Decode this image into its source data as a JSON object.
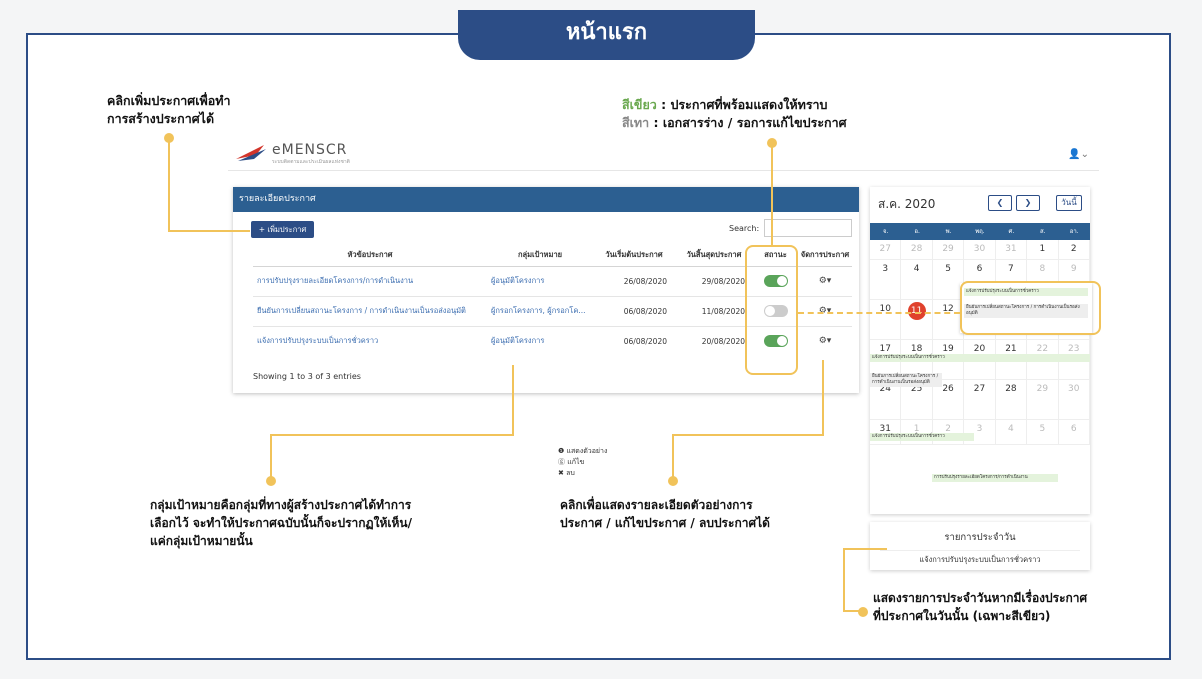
{
  "title": "หน้าแรก",
  "notes": {
    "add": [
      "คลิกเพิ่มประกาศเพื่อทำ",
      "การสร้างประกาศได้"
    ],
    "status_green_label": "สีเขียว",
    "status_green_text": " : ประกาศที่พร้อมแสดงให้ทราบ",
    "status_gray_label": "สีเทา",
    "status_gray_text": " : เอกสารร่าง / รอการแก้ไขประกาศ",
    "target": [
      "กลุ่มเป้าหมายคือกลุ่มที่ทางผู้สร้างประกาศได้ทำการ",
      "เลือกไว้ จะทำให้ประกาศฉบับนั้นก็จะปรากฏให้เห็น/",
      "แค่กลุ่มเป้าหมายนั้น"
    ],
    "action": [
      "คลิกเพื่อแสดงรายละเอียดตัวอย่างการ",
      "ประกาศ / แก้ไขประกาศ / ลบประกาศได้"
    ],
    "daily": [
      "แสดงรายการประจำวันหากมีเรื่องประกาศ",
      "ที่ประกาศในวันนั้น (เฉพาะสีเขียว)"
    ]
  },
  "app": {
    "logo": "eMENSCR",
    "logo_sub": "ระบบติดตามและประเมินผลแห่งชาติ"
  },
  "panel": {
    "header": "รายละเอียดประกาศ",
    "add_button": "+ เพิ่มประกาศ",
    "search_label": "Search:",
    "columns": [
      "หัวข้อประกาศ",
      "กลุ่มเป้าหมาย",
      "วันเริ่มต้นประกาศ",
      "วันสิ้นสุดประกาศ",
      "สถานะ",
      "จัดการประกาศ"
    ],
    "rows": [
      {
        "topic": "การปรับปรุงรายละเอียดโครงการ/การดำเนินงาน",
        "group": "ผู้อนุมัติโครงการ",
        "start": "26/08/2020",
        "end": "29/08/2020",
        "status": "on"
      },
      {
        "topic": "ยืนยันการเปลี่ยนสถานะโครงการ / การดำเนินงานเป็นรอส่งอนุมัติ",
        "group": "ผู้กรอกโครงการ, ผู้กรอกโค...",
        "start": "06/08/2020",
        "end": "11/08/2020",
        "status": "off"
      },
      {
        "topic": "แจ้งการปรับปรุงระบบเป็นการชั่วคราว",
        "group": "ผู้อนุมัติโครงการ",
        "start": "06/08/2020",
        "end": "20/08/2020",
        "status": "on"
      }
    ],
    "showing": "Showing 1 to 3 of 3 entries"
  },
  "menu": [
    "❶ แสดงตัวอย่าง",
    "ⓖ แก้ไข",
    "✖ ลบ"
  ],
  "calendar": {
    "title": "ส.ค. 2020",
    "today_btn": "วันนี้",
    "days": [
      "จ.",
      "อ.",
      "พ.",
      "พฤ.",
      "ศ.",
      "ส.",
      "อา."
    ],
    "weeks": [
      [
        "27",
        "28",
        "29",
        "30",
        "31",
        "1",
        "2"
      ],
      [
        "3",
        "4",
        "5",
        "6",
        "7",
        "8",
        "9"
      ],
      [
        "10",
        "11",
        "12",
        "13",
        "14",
        "15",
        "16"
      ],
      [
        "17",
        "18",
        "19",
        "20",
        "21",
        "22",
        "23"
      ],
      [
        "24",
        "25",
        "26",
        "27",
        "28",
        "29",
        "30"
      ],
      [
        "31",
        "1",
        "2",
        "3",
        "4",
        "5",
        "6"
      ]
    ],
    "events": {
      "e1": "แจ้งการปรับปรุงระบบเป็นการชั่วคราว",
      "e2": "ยืนยันการเปลี่ยนสถานะโครงการ / การดำเนินงานเป็นรอส่งอนุมัติ",
      "e3": "การปรับปรุงรายละเอียดโครงการ/การดำเนินงาน"
    }
  },
  "daily": {
    "title": "รายการประจำวัน",
    "item": "แจ้งการปรับปรุงระบบเป็นการชั่วคราว"
  },
  "colors": {
    "navy": "#2c4d86",
    "orange": "#f1c35a",
    "green": "#5aa45a"
  }
}
